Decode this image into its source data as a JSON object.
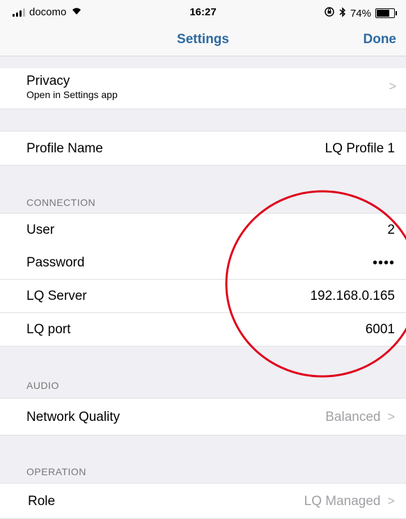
{
  "status_bar": {
    "carrier": "docomo",
    "time": "16:27",
    "battery_percent": "74%",
    "battery_level": 0.74,
    "icons": [
      "signal-icon",
      "wifi-icon",
      "orientation-lock-icon",
      "bluetooth-icon",
      "battery-icon"
    ]
  },
  "nav": {
    "title": "Settings",
    "done_label": "Done"
  },
  "privacy": {
    "title": "Privacy",
    "subtitle": "Open in Settings app"
  },
  "profile": {
    "label": "Profile Name",
    "value": "LQ Profile 1"
  },
  "connection": {
    "header": "CONNECTION",
    "rows": [
      {
        "label": "User",
        "value": "2"
      },
      {
        "label": "Password",
        "value": "••••"
      },
      {
        "label": "LQ Server",
        "value": "192.168.0.165"
      },
      {
        "label": "LQ port",
        "value": "6001"
      }
    ]
  },
  "audio": {
    "header": "AUDIO",
    "network_quality_label": "Network Quality",
    "network_quality_value": "Balanced"
  },
  "operation": {
    "header": "OPERATION",
    "role_label": "Role",
    "role_value": "LQ Managed"
  },
  "colors": {
    "accent": "#2d6aa0",
    "annotation": "#e0001b",
    "background": "#efeff4"
  }
}
